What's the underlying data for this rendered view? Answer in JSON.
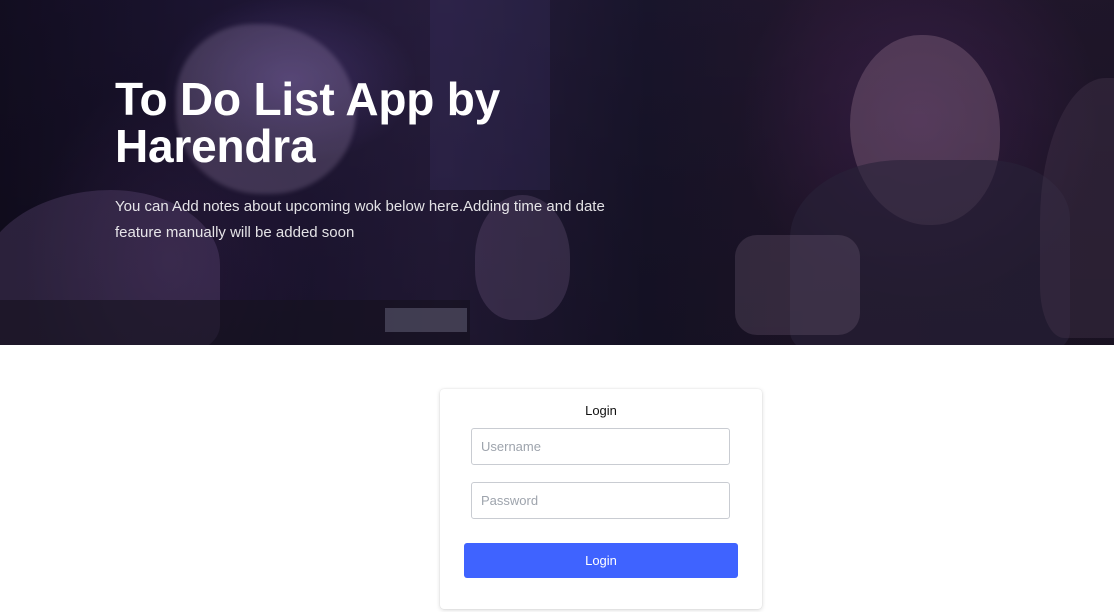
{
  "hero": {
    "title": "To Do List App by Harendra",
    "subtitle": "You can Add notes about upcoming wok below here.Adding time and date feature manually will be added soon"
  },
  "login": {
    "title": "Login",
    "username_placeholder": "Username",
    "password_placeholder": "Password",
    "button_label": "Login"
  },
  "colors": {
    "button": "#3F63FF",
    "hero_text": "#FFFFFF",
    "card_background": "#FFFFFF"
  }
}
